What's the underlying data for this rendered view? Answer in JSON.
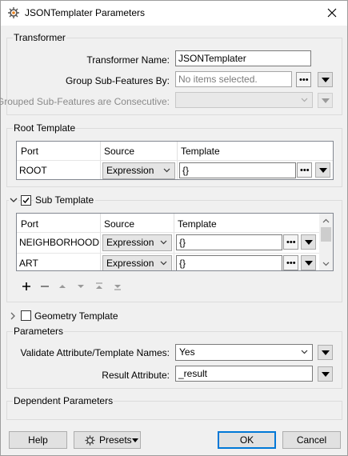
{
  "window": {
    "title": "JSONTemplater Parameters"
  },
  "transformer": {
    "group_label": "Transformer",
    "name_label": "Transformer Name:",
    "name_value": "JSONTemplater",
    "group_by_label": "Group Sub-Features By:",
    "group_by_placeholder": "No items selected.",
    "consecutive_label": "Grouped Sub-Features are Consecutive:"
  },
  "root_template": {
    "group_label": "Root Template",
    "columns": [
      "Port",
      "Source",
      "Template"
    ],
    "rows": [
      {
        "port": "ROOT",
        "source": "Expression",
        "template": "{}"
      }
    ]
  },
  "sub_template": {
    "label": "Sub Template",
    "checked": true,
    "columns": [
      "Port",
      "Source",
      "Template"
    ],
    "rows": [
      {
        "port": "NEIGHBORHOOD",
        "source": "Expression",
        "template": "{}"
      },
      {
        "port": "ART",
        "source": "Expression",
        "template": "{}"
      }
    ]
  },
  "geometry_template": {
    "label": "Geometry Template",
    "checked": false
  },
  "parameters": {
    "group_label": "Parameters",
    "validate_label": "Validate Attribute/Template Names:",
    "validate_value": "Yes",
    "result_label": "Result Attribute:",
    "result_value": "_result"
  },
  "dependent": {
    "group_label": "Dependent Parameters"
  },
  "footer": {
    "help": "Help",
    "presets": "Presets",
    "ok": "OK",
    "cancel": "Cancel"
  },
  "colors": {
    "accent": "#0078d7",
    "icon_orange": "#e8821e"
  }
}
